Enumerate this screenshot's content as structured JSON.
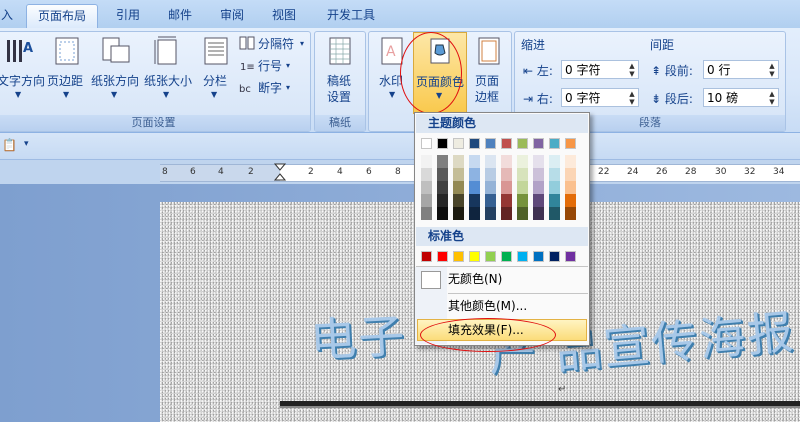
{
  "tabs": [
    "入",
    "页面布局",
    "引用",
    "邮件",
    "审阅",
    "视图",
    "开发工具"
  ],
  "page_setup": {
    "text_direction": "文字方向",
    "margins": "页边距",
    "orientation": "纸张方向",
    "size": "纸张大小",
    "columns": "分栏",
    "breaks": "分隔符",
    "line_numbers": "行号",
    "hyphenation": "断字",
    "group_label": "页面设置"
  },
  "paper": {
    "button": "稿纸\n设置",
    "btn_line1": "稿纸",
    "btn_line2": "设置",
    "group_label": "稿纸"
  },
  "background": {
    "watermark": "水印",
    "page_color": "页面颜色",
    "page_border_1": "页面",
    "page_border_2": "边框"
  },
  "paragraph": {
    "indent_title": "缩进",
    "spacing_title": "间距",
    "left_label": "左:",
    "right_label": "右:",
    "left_value": "0 字符",
    "right_value": "0 字符",
    "before_label": "段前:",
    "after_label": "段后:",
    "before_value": "0 行",
    "after_value": "10 磅",
    "group_label": "段落"
  },
  "ruler": [
    "8",
    "6",
    "4",
    "2",
    "2",
    "4",
    "6",
    "8",
    "22",
    "24",
    "26",
    "28",
    "30",
    "32",
    "34"
  ],
  "document": {
    "wordart_left": "电子",
    "wordart_mid": "产",
    "wordart_right": "品宣传海报",
    "paragraph_mark": "↵"
  },
  "dropdown": {
    "theme_colors_title": "主题颜色",
    "standard_colors_title": "标准色",
    "no_color": "无颜色(N)",
    "more_colors": "其他颜色(M)...",
    "fill_effects": "填充效果(F)...",
    "theme_top": [
      "#ffffff",
      "#000000",
      "#eeece1",
      "#1f497d",
      "#4f81bd",
      "#c0504d",
      "#9bbb59",
      "#8064a2",
      "#4bacc6",
      "#f79646"
    ],
    "theme_shades": [
      [
        "#f2f2f2",
        "#d9d9d9",
        "#bfbfbf",
        "#a6a6a6",
        "#808080"
      ],
      [
        "#7f7f7f",
        "#595959",
        "#404040",
        "#262626",
        "#0d0d0d"
      ],
      [
        "#ddd9c3",
        "#c4bd97",
        "#948a54",
        "#4a452a",
        "#1d1b10"
      ],
      [
        "#c6d9f0",
        "#8db3e2",
        "#548dd4",
        "#17365d",
        "#0f243e"
      ],
      [
        "#dbe5f1",
        "#b8cce4",
        "#95b3d7",
        "#366092",
        "#244061"
      ],
      [
        "#f2dcdb",
        "#e5b9b7",
        "#d99694",
        "#953734",
        "#632423"
      ],
      [
        "#ebf1dd",
        "#d7e3bc",
        "#c3d69b",
        "#76923c",
        "#4f6128"
      ],
      [
        "#e5e0ec",
        "#ccc1d9",
        "#b2a2c7",
        "#5f497a",
        "#3f3151"
      ],
      [
        "#dbeef3",
        "#b7dde8",
        "#92cddc",
        "#31859b",
        "#205867"
      ],
      [
        "#fdeada",
        "#fbd5b5",
        "#fac08f",
        "#e36c09",
        "#974806"
      ]
    ],
    "standard": [
      "#c00000",
      "#ff0000",
      "#ffc000",
      "#ffff00",
      "#92d050",
      "#00b050",
      "#00b0f0",
      "#0070c0",
      "#002060",
      "#7030a0"
    ]
  }
}
